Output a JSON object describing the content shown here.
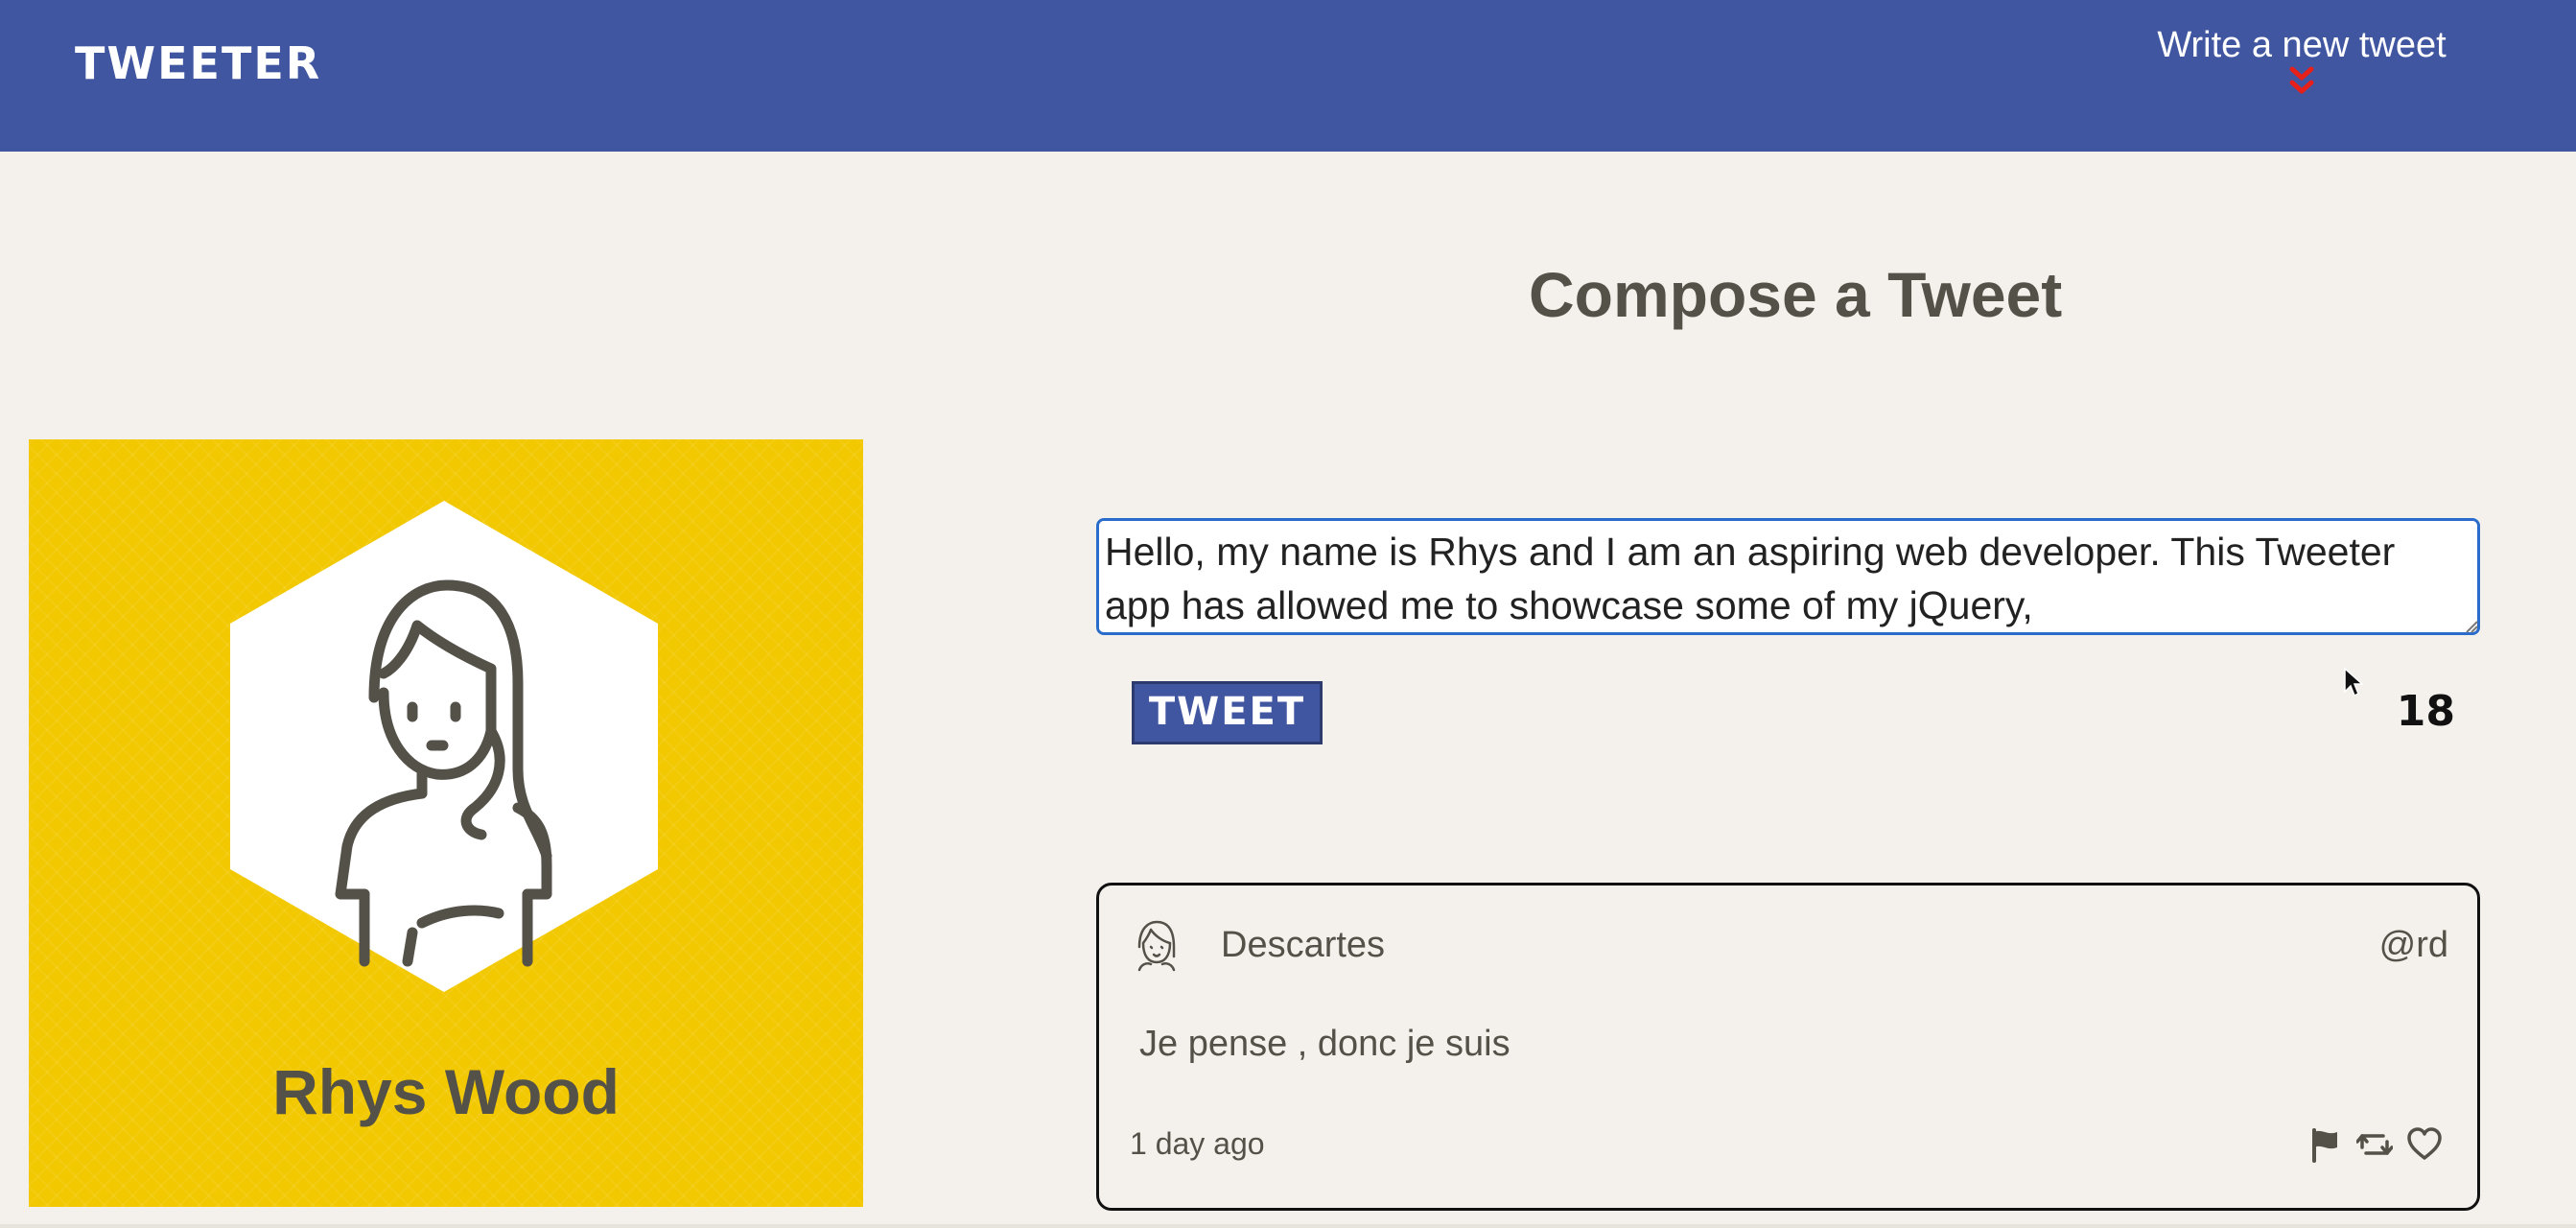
{
  "nav": {
    "brand": "TWEETER",
    "new_tweet_label": "Write a new tweet",
    "accent_color": "#4056a1",
    "chevron_color": "#e8201a"
  },
  "profile": {
    "name": "Rhys Wood",
    "background_color": "#f2c800"
  },
  "compose": {
    "title": "Compose a Tweet",
    "text": "Hello, my name is Rhys and I am an aspiring web developer. This Tweeter app has allowed me to showcase some of my jQuery, ",
    "button_label": "TWEET",
    "counter": "18"
  },
  "tweets": [
    {
      "author": "Descartes",
      "handle": "@rd",
      "content": "Je pense , donc je suis",
      "time": "1 day ago",
      "actions": [
        "flag-icon",
        "retweet-icon",
        "heart-icon"
      ]
    }
  ]
}
